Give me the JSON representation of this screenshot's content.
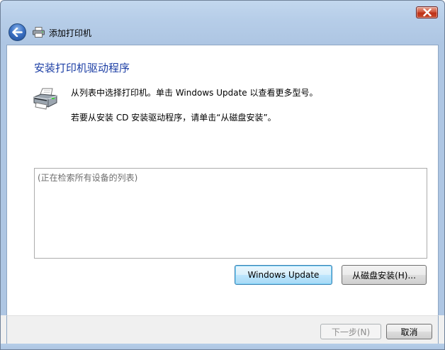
{
  "window": {
    "title": "添加打印机",
    "close_icon": "close-icon",
    "back_icon": "back-arrow-icon",
    "printer_icon": "printer-icon"
  },
  "main": {
    "heading": "安装打印机驱动程序",
    "description_line1": "从列表中选择打印机。单击 Windows Update 以查看更多型号。",
    "description_line2": "若要从安装 CD 安装驱动程序，请单击“从磁盘安装”。",
    "list_status": "(正在检索所有设备的列表)"
  },
  "buttons": {
    "windows_update": "Windows Update",
    "have_disk": "从磁盘安装(H)...",
    "next": "下一步(N)",
    "cancel": "取消"
  },
  "colors": {
    "heading": "#1d3fa5",
    "close_button": "#c8482b",
    "focused_button_border": "#3c7fb1"
  }
}
